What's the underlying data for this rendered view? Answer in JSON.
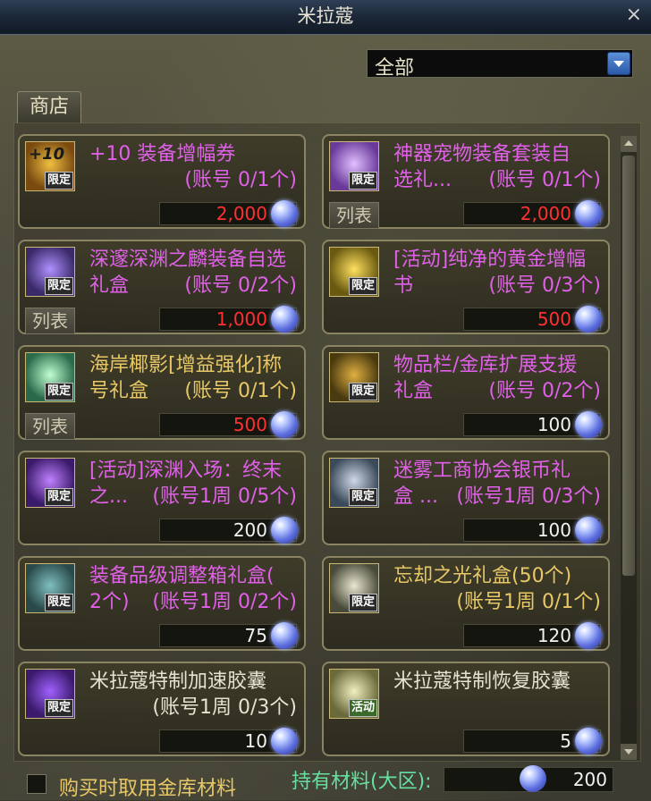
{
  "window": {
    "title": "米拉蔻",
    "close_glyph": "×"
  },
  "filter": {
    "selected": "全部"
  },
  "tabs": [
    {
      "label": "商店"
    }
  ],
  "list_button_label": "列表",
  "items": [
    {
      "name_line1": "+10 装备增幅券",
      "limit": "(账号 0/1个)",
      "price": "2,000",
      "badge": "限定",
      "icon": "plus10-ticket-icon",
      "icon_text": "+10",
      "name_color": "purple",
      "price_color": "red"
    },
    {
      "name_line1": "神器宠物装备套装自",
      "name_line2": "选礼...",
      "limit": "(账号 0/1个)",
      "price": "2,000",
      "badge": "限定",
      "icon": "pet-gear-box-icon",
      "name_color": "purple",
      "price_color": "red",
      "has_list": true
    },
    {
      "name_line1": "深邃深渊之麟装备自选",
      "name_line2": "礼盒",
      "limit": "(账号 0/2个)",
      "price": "1,000",
      "badge": "限定",
      "icon": "abyss-gear-box-icon",
      "name_color": "purple",
      "price_color": "red",
      "has_list": true
    },
    {
      "name_line1": "[活动]纯净的黄金增幅",
      "name_line2": "书",
      "limit": "(账号 0/3个)",
      "price": "500",
      "badge": "限定",
      "icon": "gold-amplify-book-icon",
      "name_color": "purple",
      "price_color": "red"
    },
    {
      "name_line1": "海岸椰影[增益强化]称",
      "name_line2": "号礼盒",
      "limit": "(账号 0/1个)",
      "price": "500",
      "badge": "限定",
      "icon": "coast-title-box-icon",
      "name_color": "gold",
      "price_color": "red",
      "has_list": true
    },
    {
      "name_line1": "物品栏/金库扩展支援",
      "name_line2": "礼盒",
      "limit": "(账号 0/2个)",
      "price": "100",
      "badge": "限定",
      "icon": "inventory-expand-box-icon",
      "name_color": "purple",
      "price_color": "white"
    },
    {
      "name_line1": "[活动]深渊入场：终末",
      "name_line2": "之...",
      "limit": "(账号1周 0/5个)",
      "price": "200",
      "badge": "限定",
      "icon": "abyss-entry-icon",
      "name_color": "purple",
      "price_color": "white"
    },
    {
      "name_line1": "迷雾工商协会银币礼",
      "name_line2": "盒 ...",
      "limit": "(账号1周 0/3个)",
      "price": "100",
      "badge": "限定",
      "icon": "silver-coin-box-icon",
      "name_color": "purple",
      "price_color": "white"
    },
    {
      "name_line1": "装备品级调整箱礼盒(",
      "name_line2": "2个)",
      "limit": "(账号1周 0/2个)",
      "price": "75",
      "badge": "限定",
      "icon": "grade-adjust-box-icon",
      "name_color": "purple",
      "price_color": "white"
    },
    {
      "name_line1": "忘却之光礼盒(50个)",
      "limit": "(账号1周 0/1个)",
      "price": "120",
      "badge": "限定",
      "icon": "forgotten-light-box-icon",
      "name_color": "gold",
      "price_color": "white"
    },
    {
      "name_line1": "米拉蔻特制加速胶囊",
      "limit": "(账号1周 0/3个)",
      "price": "10",
      "badge": "限定",
      "icon": "speed-capsule-icon",
      "name_color": "white",
      "price_color": "white"
    },
    {
      "name_line1": "米拉蔻特制恢复胶囊",
      "price": "5",
      "badge": "活动",
      "icon": "recovery-capsule-icon",
      "name_color": "white",
      "price_color": "white"
    }
  ],
  "footer": {
    "checkbox_label": "购买时取用金库材料",
    "hold_label": "持有材料(大区):",
    "hold_value": "200"
  },
  "colors": {
    "purple": "#e060e8",
    "gold": "#e8c866",
    "price_red": "#ff3030",
    "hold_green": "#66e0a0"
  }
}
